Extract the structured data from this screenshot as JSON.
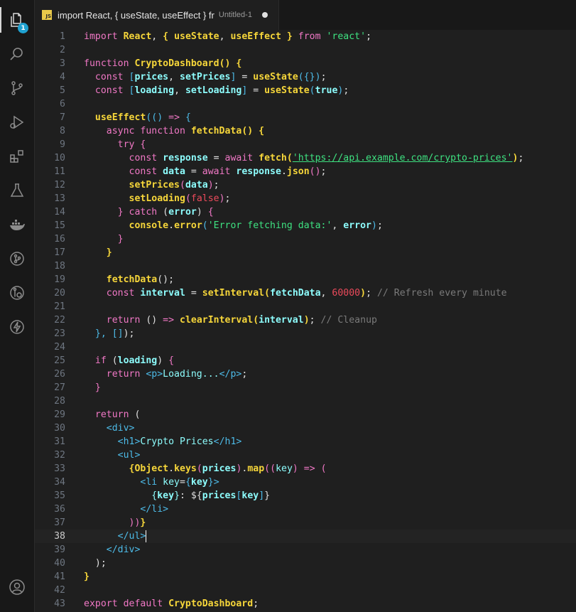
{
  "tab": {
    "title": "import React, { useState, useEffect } fr",
    "description": "Untitled-1",
    "file_icon_label": "JS"
  },
  "activity": {
    "explorer_badge": "1",
    "icons": [
      "files-icon",
      "search-icon",
      "source-control-icon",
      "run-debug-icon",
      "extensions-icon",
      "testing-icon",
      "docker-icon",
      "git-graph-icon",
      "gitlens-icon",
      "lightning-icon",
      "account-icon"
    ]
  },
  "editor": {
    "current_line": 38,
    "lines": [
      {
        "n": "1"
      },
      {
        "n": "2"
      },
      {
        "n": "3"
      },
      {
        "n": "4"
      },
      {
        "n": "5"
      },
      {
        "n": "6"
      },
      {
        "n": "7"
      },
      {
        "n": "8"
      },
      {
        "n": "9"
      },
      {
        "n": "10"
      },
      {
        "n": "11"
      },
      {
        "n": "12"
      },
      {
        "n": "13"
      },
      {
        "n": "14"
      },
      {
        "n": "15"
      },
      {
        "n": "16"
      },
      {
        "n": "17"
      },
      {
        "n": "18"
      },
      {
        "n": "19"
      },
      {
        "n": "20"
      },
      {
        "n": "21"
      },
      {
        "n": "22"
      },
      {
        "n": "23"
      },
      {
        "n": "24"
      },
      {
        "n": "25"
      },
      {
        "n": "26"
      },
      {
        "n": "27"
      },
      {
        "n": "28"
      },
      {
        "n": "29"
      },
      {
        "n": "30"
      },
      {
        "n": "31"
      },
      {
        "n": "32"
      },
      {
        "n": "33"
      },
      {
        "n": "34"
      },
      {
        "n": "35"
      },
      {
        "n": "36"
      },
      {
        "n": "37"
      },
      {
        "n": "38"
      },
      {
        "n": "39"
      },
      {
        "n": "40"
      },
      {
        "n": "41"
      },
      {
        "n": "42"
      },
      {
        "n": "43"
      }
    ],
    "tokens": [
      [
        [
          "kw",
          "import "
        ],
        [
          "fn",
          "React"
        ],
        [
          "pn",
          ", "
        ],
        [
          "fn",
          "{ "
        ],
        [
          "fn",
          "useState"
        ],
        [
          "pn",
          ", "
        ],
        [
          "fn",
          "useEffect "
        ],
        [
          "fn",
          "} "
        ],
        [
          "kw",
          "from "
        ],
        [
          "str",
          "'react'"
        ],
        [
          "pn",
          ";"
        ]
      ],
      [],
      [
        [
          "kw",
          "function "
        ],
        [
          "fn",
          "CryptoDashboard"
        ],
        [
          "fn",
          "() {"
        ]
      ],
      [
        [
          "pn",
          "  "
        ],
        [
          "kw",
          "const "
        ],
        [
          "bk",
          "["
        ],
        [
          "vr",
          "prices"
        ],
        [
          "pn",
          ", "
        ],
        [
          "vr",
          "setPrices"
        ],
        [
          "bk",
          "]"
        ],
        [
          "pn",
          " = "
        ],
        [
          "fn",
          "useState"
        ],
        [
          "bk",
          "({})"
        ],
        [
          "pn",
          ";"
        ]
      ],
      [
        [
          "pn",
          "  "
        ],
        [
          "kw",
          "const "
        ],
        [
          "bk",
          "["
        ],
        [
          "vr",
          "loading"
        ],
        [
          "pn",
          ", "
        ],
        [
          "vr",
          "setLoading"
        ],
        [
          "bk",
          "]"
        ],
        [
          "pn",
          " = "
        ],
        [
          "fn",
          "useState"
        ],
        [
          "bk",
          "("
        ],
        [
          "vr",
          "true"
        ],
        [
          "bk",
          ")"
        ],
        [
          "pn",
          ";"
        ]
      ],
      [],
      [
        [
          "pn",
          "  "
        ],
        [
          "fn",
          "useEffect"
        ],
        [
          "bk",
          "(() "
        ],
        [
          "kw",
          "=> "
        ],
        [
          "bk",
          "{"
        ]
      ],
      [
        [
          "pn",
          "    "
        ],
        [
          "kw",
          "async function "
        ],
        [
          "fn",
          "fetchData"
        ],
        [
          "fn",
          "() {"
        ]
      ],
      [
        [
          "pn",
          "      "
        ],
        [
          "kw",
          "try "
        ],
        [
          "kw",
          "{"
        ]
      ],
      [
        [
          "pn",
          "        "
        ],
        [
          "kw",
          "const "
        ],
        [
          "vr",
          "response"
        ],
        [
          "pn",
          " = "
        ],
        [
          "kw",
          "await "
        ],
        [
          "fn",
          "fetch"
        ],
        [
          "fn",
          "("
        ],
        [
          "url",
          "'https://api.example.com/crypto-prices'"
        ],
        [
          "fn",
          ")"
        ],
        [
          "pn",
          ";"
        ]
      ],
      [
        [
          "pn",
          "        "
        ],
        [
          "kw",
          "const "
        ],
        [
          "vr",
          "data"
        ],
        [
          "pn",
          " = "
        ],
        [
          "kw",
          "await "
        ],
        [
          "vr",
          "response"
        ],
        [
          "pn",
          "."
        ],
        [
          "fn",
          "json"
        ],
        [
          "kw",
          "()"
        ],
        [
          "pn",
          ";"
        ]
      ],
      [
        [
          "pn",
          "        "
        ],
        [
          "fn",
          "setPrices"
        ],
        [
          "kw",
          "("
        ],
        [
          "vr",
          "data"
        ],
        [
          "kw",
          ")"
        ],
        [
          "pn",
          ";"
        ]
      ],
      [
        [
          "pn",
          "        "
        ],
        [
          "fn",
          "setLoading"
        ],
        [
          "kw",
          "("
        ],
        [
          "num",
          "false"
        ],
        [
          "kw",
          ")"
        ],
        [
          "pn",
          ";"
        ]
      ],
      [
        [
          "pn",
          "      "
        ],
        [
          "kw",
          "} catch "
        ],
        [
          "pn",
          "("
        ],
        [
          "vr",
          "error"
        ],
        [
          "pn",
          ") "
        ],
        [
          "kw",
          "{"
        ]
      ],
      [
        [
          "pn",
          "        "
        ],
        [
          "fn",
          "console"
        ],
        [
          "pn",
          "."
        ],
        [
          "fn",
          "error"
        ],
        [
          "bk",
          "("
        ],
        [
          "str",
          "'Error fetching data:'"
        ],
        [
          "pn",
          ", "
        ],
        [
          "vr",
          "error"
        ],
        [
          "bk",
          ")"
        ],
        [
          "pn",
          ";"
        ]
      ],
      [
        [
          "pn",
          "      "
        ],
        [
          "kw",
          "}"
        ]
      ],
      [
        [
          "pn",
          "    "
        ],
        [
          "fn",
          "}"
        ]
      ],
      [],
      [
        [
          "pn",
          "    "
        ],
        [
          "fn",
          "fetchData"
        ],
        [
          "pn",
          "();"
        ]
      ],
      [
        [
          "pn",
          "    "
        ],
        [
          "kw",
          "const "
        ],
        [
          "vr",
          "interval"
        ],
        [
          "pn",
          " = "
        ],
        [
          "fn",
          "setInterval"
        ],
        [
          "fn",
          "("
        ],
        [
          "vr",
          "fetchData"
        ],
        [
          "pn",
          ", "
        ],
        [
          "num",
          "60000"
        ],
        [
          "fn",
          ")"
        ],
        [
          "pn",
          "; "
        ],
        [
          "cm",
          "// Refresh every minute"
        ]
      ],
      [],
      [
        [
          "pn",
          "    "
        ],
        [
          "kw",
          "return "
        ],
        [
          "pn",
          "() "
        ],
        [
          "kw",
          "=> "
        ],
        [
          "fn",
          "clearInterval"
        ],
        [
          "fn",
          "("
        ],
        [
          "vr",
          "interval"
        ],
        [
          "fn",
          ")"
        ],
        [
          "pn",
          "; "
        ],
        [
          "cm",
          "// Cleanup"
        ]
      ],
      [
        [
          "pn",
          "  "
        ],
        [
          "bk",
          "}, []"
        ],
        [
          "pn",
          ");"
        ]
      ],
      [],
      [
        [
          "pn",
          "  "
        ],
        [
          "kw",
          "if "
        ],
        [
          "pn",
          "("
        ],
        [
          "vr",
          "loading"
        ],
        [
          "pn",
          ") "
        ],
        [
          "kw",
          "{"
        ]
      ],
      [
        [
          "pn",
          "    "
        ],
        [
          "kw",
          "return "
        ],
        [
          "tag",
          "<p>"
        ],
        [
          "pr",
          "Loading..."
        ],
        [
          "tag",
          "</p>"
        ],
        [
          "pn",
          ";"
        ]
      ],
      [
        [
          "pn",
          "  "
        ],
        [
          "kw",
          "}"
        ]
      ],
      [],
      [
        [
          "pn",
          "  "
        ],
        [
          "kw",
          "return "
        ],
        [
          "pn",
          "("
        ]
      ],
      [
        [
          "pn",
          "    "
        ],
        [
          "tag",
          "<div>"
        ]
      ],
      [
        [
          "pn",
          "      "
        ],
        [
          "tag",
          "<h1>"
        ],
        [
          "pr",
          "Crypto Prices"
        ],
        [
          "tag",
          "</h1>"
        ]
      ],
      [
        [
          "pn",
          "      "
        ],
        [
          "tag",
          "<ul>"
        ]
      ],
      [
        [
          "pn",
          "        "
        ],
        [
          "fn",
          "{"
        ],
        [
          "fn",
          "Object"
        ],
        [
          "pn",
          "."
        ],
        [
          "fn",
          "keys"
        ],
        [
          "kw",
          "("
        ],
        [
          "vr",
          "prices"
        ],
        [
          "kw",
          ")"
        ],
        [
          "pn",
          "."
        ],
        [
          "fn",
          "map"
        ],
        [
          "kw",
          "(("
        ],
        [
          "pr",
          "key"
        ],
        [
          "kw",
          ") "
        ],
        [
          "kw",
          "=> "
        ],
        [
          "kw",
          "("
        ]
      ],
      [
        [
          "pn",
          "          "
        ],
        [
          "tag",
          "<li "
        ],
        [
          "pr",
          "key"
        ],
        [
          "pn",
          "="
        ],
        [
          "bk",
          "{"
        ],
        [
          "vr",
          "key"
        ],
        [
          "bk",
          "}"
        ],
        [
          "tag",
          ">"
        ]
      ],
      [
        [
          "pn",
          "            "
        ],
        [
          "pr",
          "{"
        ],
        [
          "vr",
          "key"
        ],
        [
          "pr",
          "}"
        ],
        [
          "pn",
          ": ${"
        ],
        [
          "vr",
          "prices"
        ],
        [
          "bk",
          "["
        ],
        [
          "vr",
          "key"
        ],
        [
          "bk",
          "]"
        ],
        [
          "pn",
          "}"
        ]
      ],
      [
        [
          "pn",
          "          "
        ],
        [
          "tag",
          "</li>"
        ]
      ],
      [
        [
          "pn",
          "        "
        ],
        [
          "kw",
          "))"
        ],
        [
          "fn",
          "}"
        ]
      ],
      [
        [
          "pn",
          "      "
        ],
        [
          "tag",
          "</ul>"
        ]
      ],
      [
        [
          "pn",
          "    "
        ],
        [
          "tag",
          "</div>"
        ]
      ],
      [
        [
          "pn",
          "  "
        ],
        [
          "pn",
          ");"
        ]
      ],
      [
        [
          "fn",
          "}"
        ]
      ],
      [],
      [
        [
          "kw",
          "export default "
        ],
        [
          "fn",
          "CryptoDashboard"
        ],
        [
          "pn",
          ";"
        ]
      ]
    ]
  }
}
